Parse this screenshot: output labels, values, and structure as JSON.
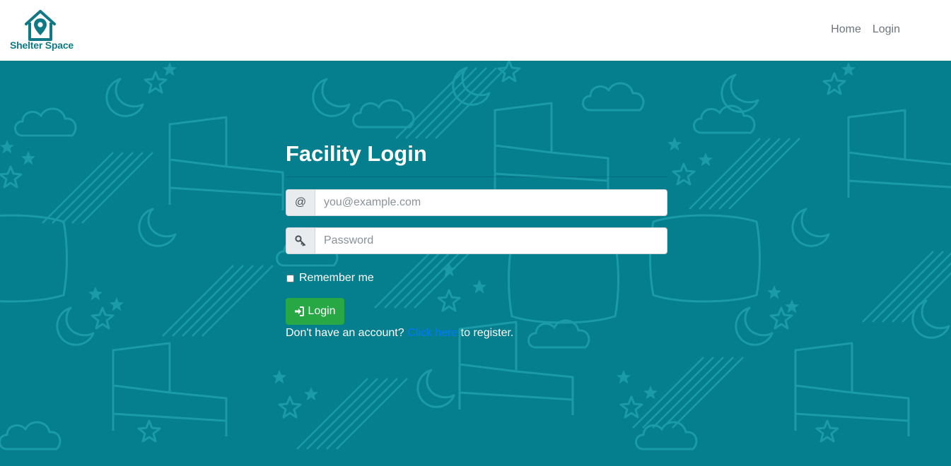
{
  "colors": {
    "brand": "#0f7a86",
    "hero_background": "#057e8e",
    "pattern_stroke": "#1a9ba7",
    "success": "#28a745",
    "link": "#007bff",
    "nav_text": "#6c757d"
  },
  "brand": {
    "name": "Shelter Space",
    "icon": "house-pin-icon"
  },
  "nav": {
    "items": [
      {
        "label": "Home"
      },
      {
        "label": "Login"
      }
    ]
  },
  "form": {
    "title": "Facility Login",
    "email": {
      "addon": "@",
      "placeholder": "you@example.com",
      "value": ""
    },
    "password": {
      "addon_icon": "key-icon",
      "placeholder": "Password",
      "value": ""
    },
    "remember": {
      "label": "Remember me",
      "checked": false
    },
    "submit": {
      "icon": "sign-in-icon",
      "label": "Login"
    },
    "register": {
      "prefix": "Don't have an account?",
      "link_text": "Click here",
      "suffix": "to register."
    }
  }
}
